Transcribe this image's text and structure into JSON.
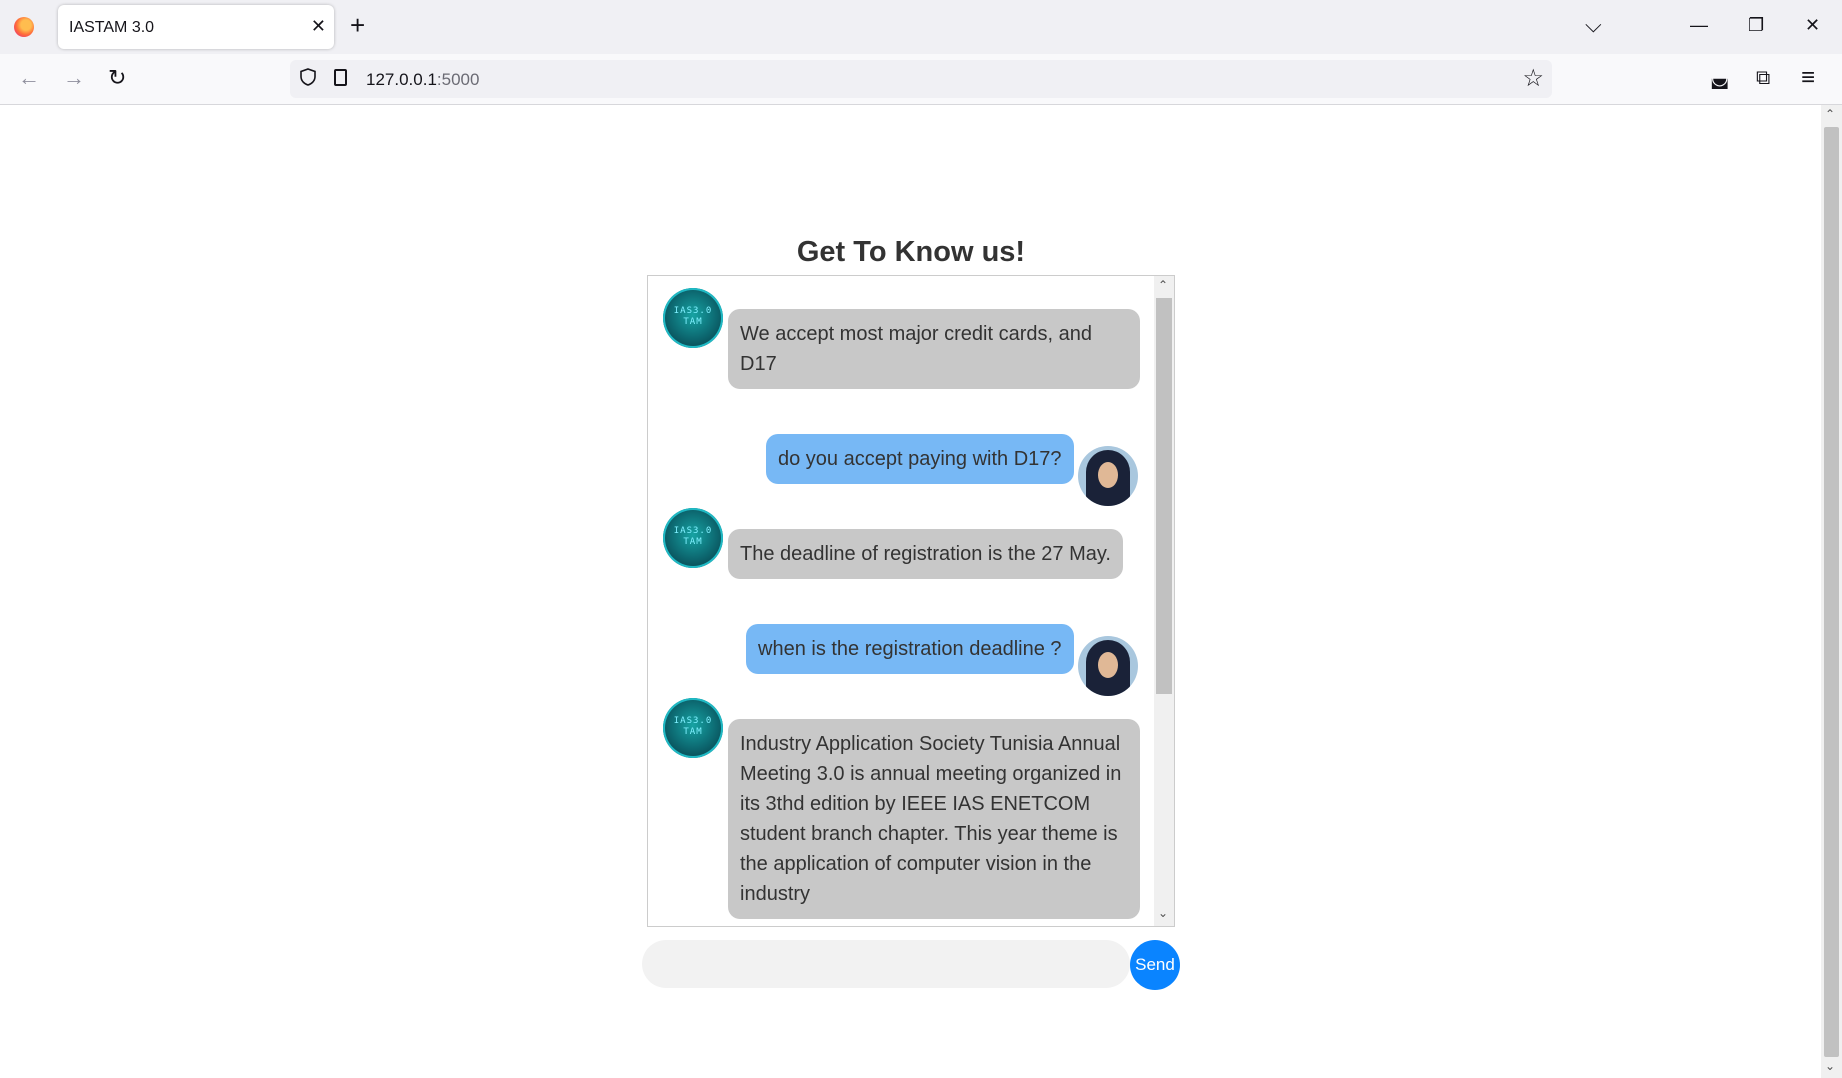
{
  "browser": {
    "tab_title": "IASTAM 3.0",
    "tab_close": "✕",
    "new_tab": "+",
    "list_tabs": "⌵",
    "minimize": "—",
    "restore": "❐",
    "close": "✕",
    "back": "←",
    "forward": "→",
    "reload": "↻",
    "url_host": "127.0.0.1",
    "url_port": ":5000",
    "bookmark": "☆",
    "pocket": "◛",
    "extensions": "⧉",
    "menu": "≡"
  },
  "page": {
    "heading": "Get To Know us!",
    "logo_text_line1": "IAS3.0",
    "logo_text_line2": "TAM"
  },
  "chat": {
    "messages": [
      {
        "sender": "bot",
        "text": "We accept most major credit cards, and D17"
      },
      {
        "sender": "user",
        "text": "do you accept paying with D17?"
      },
      {
        "sender": "bot",
        "text": "The deadline of registration is the 27 May."
      },
      {
        "sender": "user",
        "text": "when is the registration deadline ?"
      },
      {
        "sender": "bot",
        "text": "Industry Application Society Tunisia Annual Meeting 3.0 is annual meeting organized in its 3thd edition by IEEE IAS ENETCOM student branch chapter. This year theme is the application of computer vision in the industry"
      }
    ]
  },
  "input": {
    "value": "",
    "placeholder": "",
    "send_label": "Send"
  },
  "colors": {
    "bot_bubble": "#c8c8c8",
    "user_bubble": "#77b8f5",
    "send_button": "#0a84ff"
  }
}
